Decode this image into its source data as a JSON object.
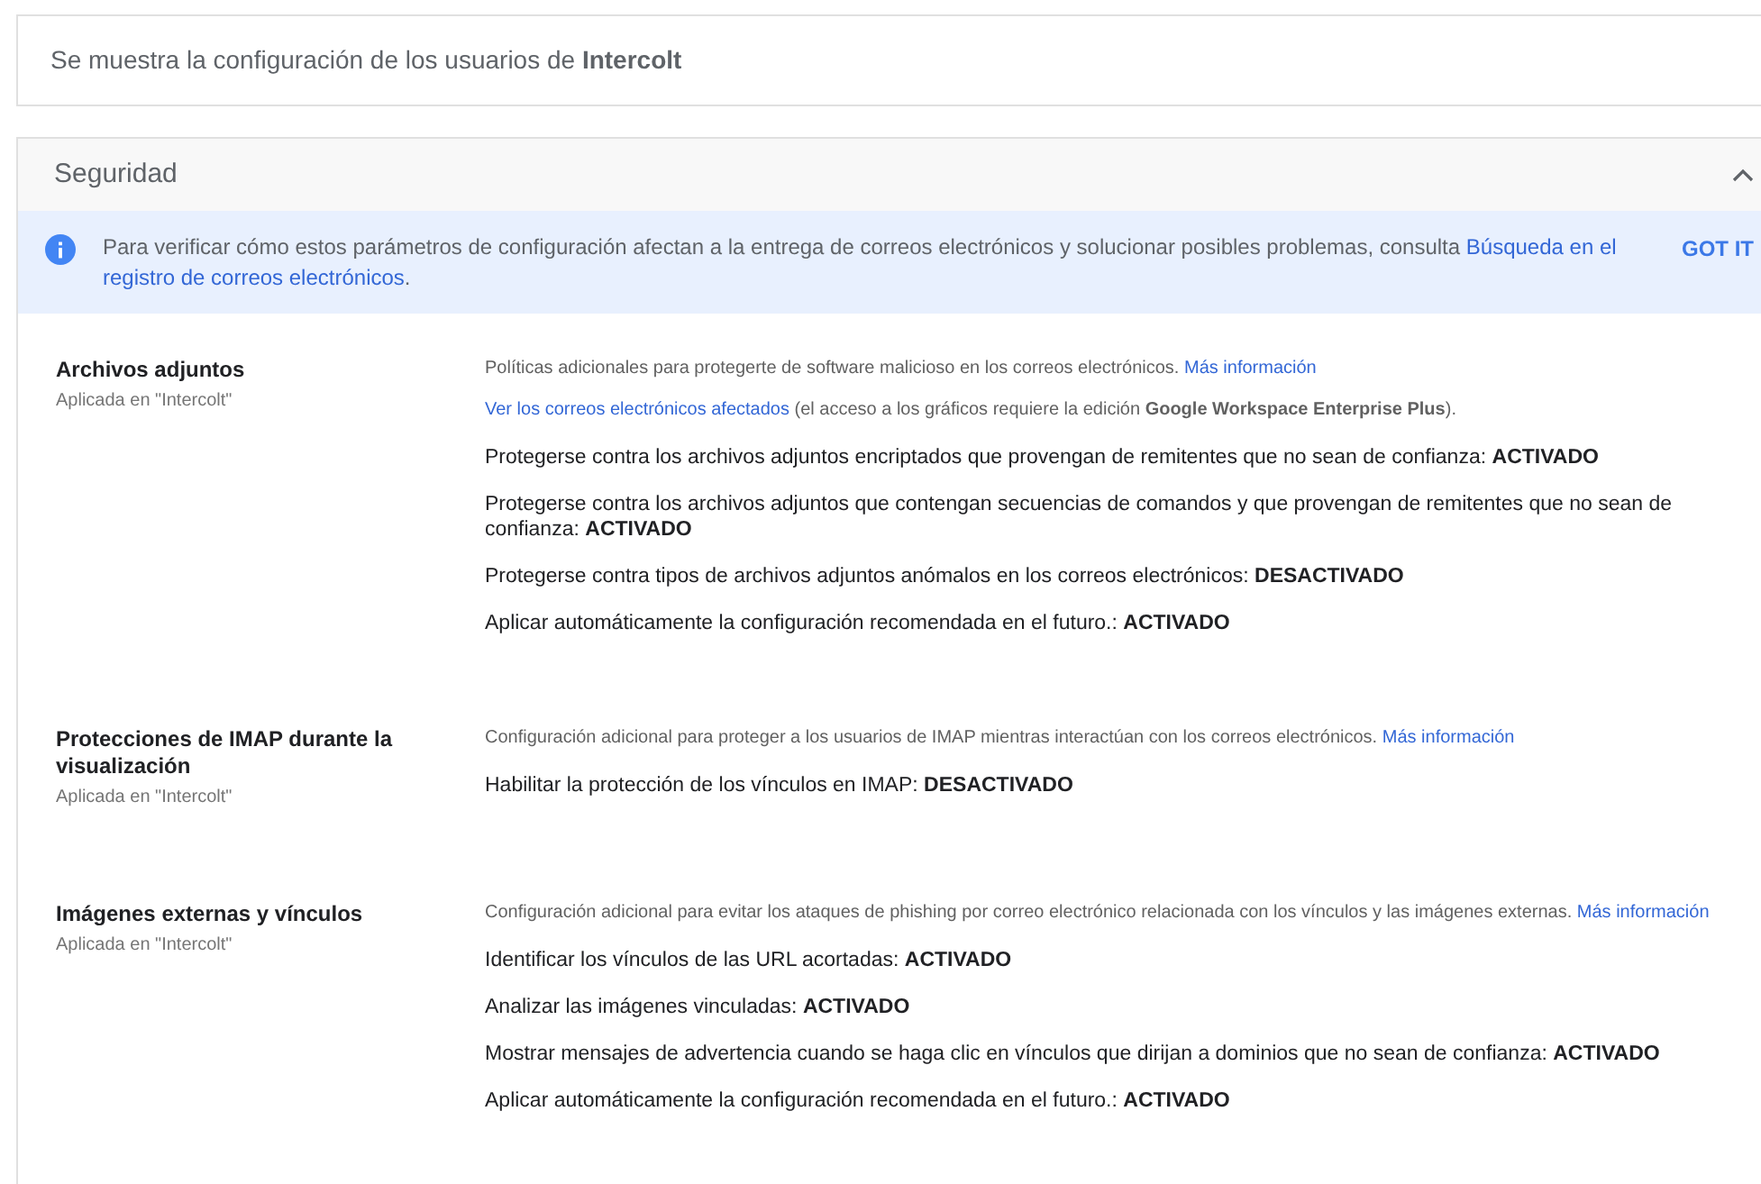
{
  "header": {
    "text": "Se muestra la configuración de los usuarios de **Intercolt**"
  },
  "section": {
    "title": "Seguridad",
    "expanded": true,
    "banner": {
      "text": "Para verificar cómo estos parámetros de configuración afectan a la entrega de correos electrónicos y solucionar posibles problemas, consulta",
      "link_lines": [
        "Búsqueda en el",
        "registro de correos electrónicos"
      ],
      "suffix": ".",
      "button": "GOT IT"
    },
    "groups": [
      {
        "title": "Archivos adjuntos",
        "applied": "Aplicada en \"Intercolt\"",
        "description": "Políticas adicionales para protegerte de software malicioso en los correos electrónicos.",
        "link": "Más información",
        "note_link": "Ver los correos electrónicos afectados",
        "note_text": "(el acceso a los gráficos requiere la edición **Google Workspace Enterprise Plus**).",
        "settings": [
          {
            "label": "Protegerse contra los archivos adjuntos encriptados que provengan de remitentes que no sean de confianza:",
            "value": "ACTIVADO"
          },
          {
            "label": "Protegerse contra los archivos adjuntos que contengan secuencias de comandos y que provengan de remitentes que no sean de confianza:",
            "value": "ACTIVADO"
          },
          {
            "label": "Protegerse contra tipos de archivos adjuntos anómalos en los correos electrónicos:",
            "value": "DESACTIVADO"
          },
          {
            "label": "Aplicar automáticamente la configuración recomendada en el futuro.:",
            "value": "ACTIVADO"
          }
        ]
      },
      {
        "title": "Protecciones de IMAP durante la visualización",
        "applied": "Aplicada en \"Intercolt\"",
        "description": "Configuración adicional para proteger a los usuarios de IMAP mientras interactúan con los correos electrónicos.",
        "link": "Más información",
        "settings": [
          {
            "label": "Habilitar la protección de los vínculos en IMAP:",
            "value": "DESACTIVADO"
          }
        ]
      },
      {
        "title": "Imágenes externas y vínculos",
        "applied": "Aplicada en \"Intercolt\"",
        "description": "Configuración adicional para evitar los ataques de phishing por correo electrónico relacionada con los vínculos y las imágenes externas.",
        "link": "Más información",
        "settings": [
          {
            "label": "Identificar los vínculos de las URL acortadas:",
            "value": "ACTIVADO"
          },
          {
            "label": "Analizar las imágenes vinculadas:",
            "value": "ACTIVADO"
          },
          {
            "label": "Mostrar mensajes de advertencia cuando se haga clic en vínculos que dirijan a dominios que no sean de confianza:",
            "value": "ACTIVADO"
          },
          {
            "label": "Aplicar automáticamente la configuración recomendada en el futuro.:",
            "value": "ACTIVADO"
          }
        ]
      }
    ]
  }
}
